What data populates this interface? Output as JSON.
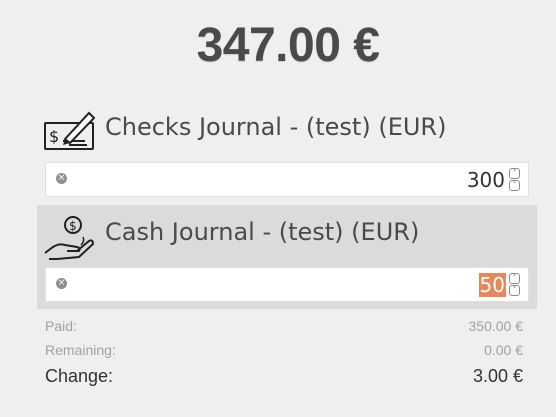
{
  "total": {
    "amount": "347.00 €"
  },
  "journals": [
    {
      "name": "Checks Journal - (test) (EUR)",
      "icon": "check-payment-icon",
      "amount": "300",
      "selected": false
    },
    {
      "name": "Cash Journal - (test) (EUR)",
      "icon": "cash-hand-icon",
      "amount": "50",
      "selected": true
    }
  ],
  "summary": {
    "paid_label": "Paid:",
    "paid_value": "350.00 €",
    "remaining_label": "Remaining:",
    "remaining_value": "0.00 €",
    "change_label": "Change:",
    "change_value": "3.00 €"
  },
  "colors": {
    "background": "#f0eeee",
    "selected_row": "#dddada",
    "selection_highlight": "#e8885a",
    "text_dark": "#4a4a4a",
    "text_muted": "#a3a0a0"
  }
}
